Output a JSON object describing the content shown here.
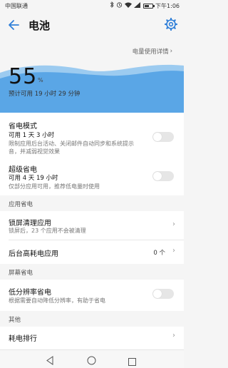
{
  "status_bar": {
    "carrier": "中国联通",
    "time": "下午1:06"
  },
  "app_bar": {
    "title": "电池"
  },
  "usage_link": "电量使用详情",
  "battery": {
    "level": "55",
    "unit": "%",
    "remaining": "预计可用 19 小时 29 分钟",
    "accent": "#5aa6e6"
  },
  "power_saving": {
    "title": "省电模式",
    "subtitle": "可用 1 天 3 小时",
    "desc": "限制应用后台活动、关闭邮件自动同步和系统提示音，并减弱视觉效果",
    "enabled": false
  },
  "super_saving": {
    "title": "超级省电",
    "subtitle": "可用 4 天 19 小时",
    "desc": "仅部分应用可用，推荐低电量时使用",
    "enabled": false
  },
  "app_section": {
    "header": "应用省电",
    "lock_clean": {
      "title": "锁屏清理应用",
      "desc": "锁屏后，23 个应用不会被清理"
    },
    "high_drain": {
      "title": "后台高耗电应用",
      "value": "0 个"
    }
  },
  "screen_section": {
    "header": "屏幕省电",
    "low_res": {
      "title": "低分辨率省电",
      "desc": "根据需要自动降低分辨率，有助于省电",
      "enabled": false
    }
  },
  "other_section": {
    "header": "其他",
    "ranking": {
      "title": "耗电排行"
    }
  }
}
